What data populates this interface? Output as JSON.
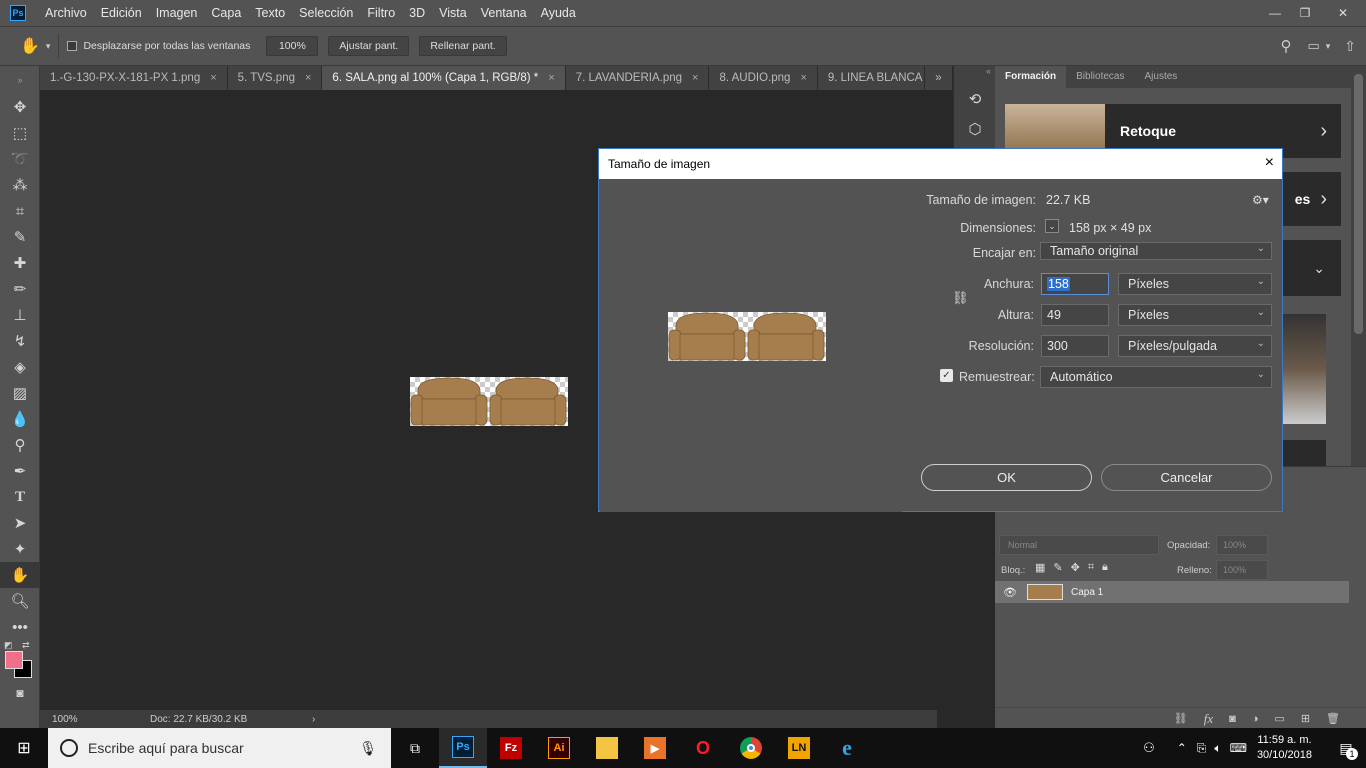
{
  "menubar": {
    "logo": "Ps",
    "items": [
      "Archivo",
      "Edición",
      "Imagen",
      "Capa",
      "Texto",
      "Selección",
      "Filtro",
      "3D",
      "Vista",
      "Ventana",
      "Ayuda"
    ]
  },
  "options": {
    "scroll_all_label": "Desplazarse por todas las ventanas",
    "zoom_value": "100%",
    "fit_screen": "Ajustar pant.",
    "fill_screen": "Rellenar pant."
  },
  "tabs": [
    {
      "label": "1.-G-130-PX-X-181-PX 1.png",
      "close": "×"
    },
    {
      "label": "5. TVS.png",
      "close": "×"
    },
    {
      "label": "6. SALA.png al 100% (Capa 1, RGB/8) *",
      "close": "×"
    },
    {
      "label": "7. LAVANDERIA.png",
      "close": "×"
    },
    {
      "label": "8. AUDIO.png",
      "close": "×"
    },
    {
      "label": "9. LINEA BLANCA",
      "close": ""
    }
  ],
  "tabs_overflow": "»",
  "status": {
    "zoom": "100%",
    "doc": "Doc: 22.7 KB/30.2 KB",
    "arrow": "›"
  },
  "right_panel": {
    "tabs": [
      "Formación",
      "Bibliotecas",
      "Ajustes"
    ],
    "card_title": "Retoque",
    "card_partial": "es"
  },
  "layers": {
    "blend_mode": "Normal",
    "opacity_label": "Opacidad:",
    "opacity_value": "100%",
    "lock_label": "Bloq.:",
    "fill_label": "Relleno:",
    "fill_value": "100%",
    "layer_name": "Capa 1",
    "fx": "fx"
  },
  "dialog": {
    "title": "Tamaño de imagen",
    "close": "×",
    "size_label": "Tamaño de imagen:",
    "size_value": "22.7 KB",
    "dims_label": "Dimensiones:",
    "dims_value": "158 px × 49 px",
    "fit_label": "Encajar en:",
    "fit_value": "Tamaño original",
    "width_label": "Anchura:",
    "width_value": "158",
    "width_unit": "Píxeles",
    "height_label": "Altura:",
    "height_value": "49",
    "height_unit": "Píxeles",
    "res_label": "Resolución:",
    "res_value": "300",
    "res_unit": "Píxeles/pulgada",
    "resample_label": "Remuestrear:",
    "resample_value": "Automático",
    "ok": "OK",
    "cancel": "Cancelar"
  },
  "taskbar": {
    "search_placeholder": "Escribe aquí para buscar",
    "apps": [
      "Ps",
      "Fz",
      "Ai",
      "",
      "",
      "O",
      "",
      "LN",
      "e"
    ],
    "time": "11:59 a. m.",
    "date": "30/10/2018",
    "notifications": "1"
  },
  "colors": {
    "foreground": "#f26f8a",
    "background": "#000000",
    "sofa": "#a67e4d"
  }
}
